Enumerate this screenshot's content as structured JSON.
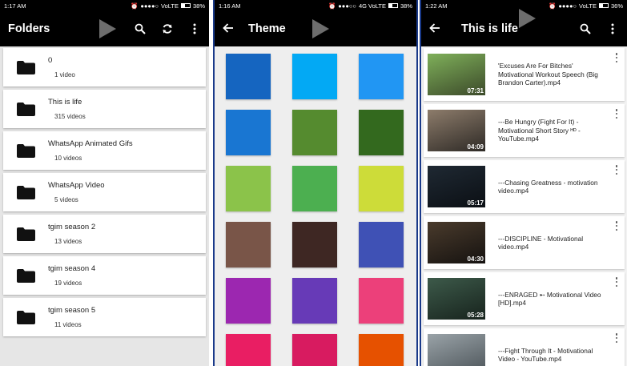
{
  "folders_screen": {
    "status": {
      "time": "1:17 AM",
      "signal": "●●●●○",
      "carrier": "VoLTE",
      "battery": "38%"
    },
    "title": "Folders",
    "icons": [
      "search-icon",
      "refresh-icon",
      "more-vert-icon"
    ],
    "items": [
      {
        "name": "0",
        "count": "1 video"
      },
      {
        "name": "This is life",
        "count": "315 videos"
      },
      {
        "name": "WhatsApp Animated Gifs",
        "count": "10 videos"
      },
      {
        "name": "WhatsApp Video",
        "count": "5 videos"
      },
      {
        "name": "tgim season 2",
        "count": "13 videos"
      },
      {
        "name": "tgim season 4",
        "count": "19 videos"
      },
      {
        "name": "tgim season 5",
        "count": "11 videos"
      }
    ]
  },
  "theme_screen": {
    "status": {
      "time": "1:16 AM",
      "signal": "●●●○○",
      "carrier": "4G VoLTE",
      "battery": "38%"
    },
    "title": "Theme",
    "swatches": [
      "#1565c0",
      "#03a9f4",
      "#2196f3",
      "#1976d2",
      "#558b2f",
      "#33691e",
      "#8bc34a",
      "#4caf50",
      "#cddc39",
      "#795548",
      "#3e2723",
      "#3f51b5",
      "#9c27b0",
      "#673ab7",
      "#ec407a",
      "#e91e63",
      "#d81b60",
      "#e65100"
    ]
  },
  "videos_screen": {
    "status": {
      "time": "1:22 AM",
      "signal": "●●●●○",
      "carrier": "VoLTE",
      "battery": "36%"
    },
    "title": "This is life",
    "icons": [
      "search-icon",
      "more-vert-icon"
    ],
    "items": [
      {
        "title": "'Excuses Are For Bitches' Motivational Workout Speech (Big Brandon Carter).mp4",
        "duration": "07:31",
        "thumb": [
          "#7fb05a",
          "#3c4a2a"
        ]
      },
      {
        "title": "---Be Hungry (Fight For It) - Motivational Short Story ᴴᴰ - YouTube.mp4",
        "duration": "04:09",
        "thumb": [
          "#8d7c6b",
          "#2e2a26"
        ]
      },
      {
        "title": "---Chasing Greatness - motivation video.mp4",
        "duration": "05:17",
        "thumb": [
          "#1f2933",
          "#0b0f14"
        ]
      },
      {
        "title": "---DISCIPLINE - Motivational video.mp4",
        "duration": "04:30",
        "thumb": [
          "#4a3b2c",
          "#151210"
        ]
      },
      {
        "title": "---ENRAGED ➸ Motivational Video [HD].mp4",
        "duration": "05:28",
        "thumb": [
          "#3d5a4a",
          "#17231d"
        ]
      },
      {
        "title": "---Fight Through It - Motivational Video - YouTube.mp4",
        "duration": "",
        "thumb": [
          "#9aa3a8",
          "#4a5257"
        ]
      }
    ]
  },
  "colors": {
    "toolbar_bg": "#000000",
    "status_bg": "#000000",
    "watermark": "#6d6d6d"
  }
}
